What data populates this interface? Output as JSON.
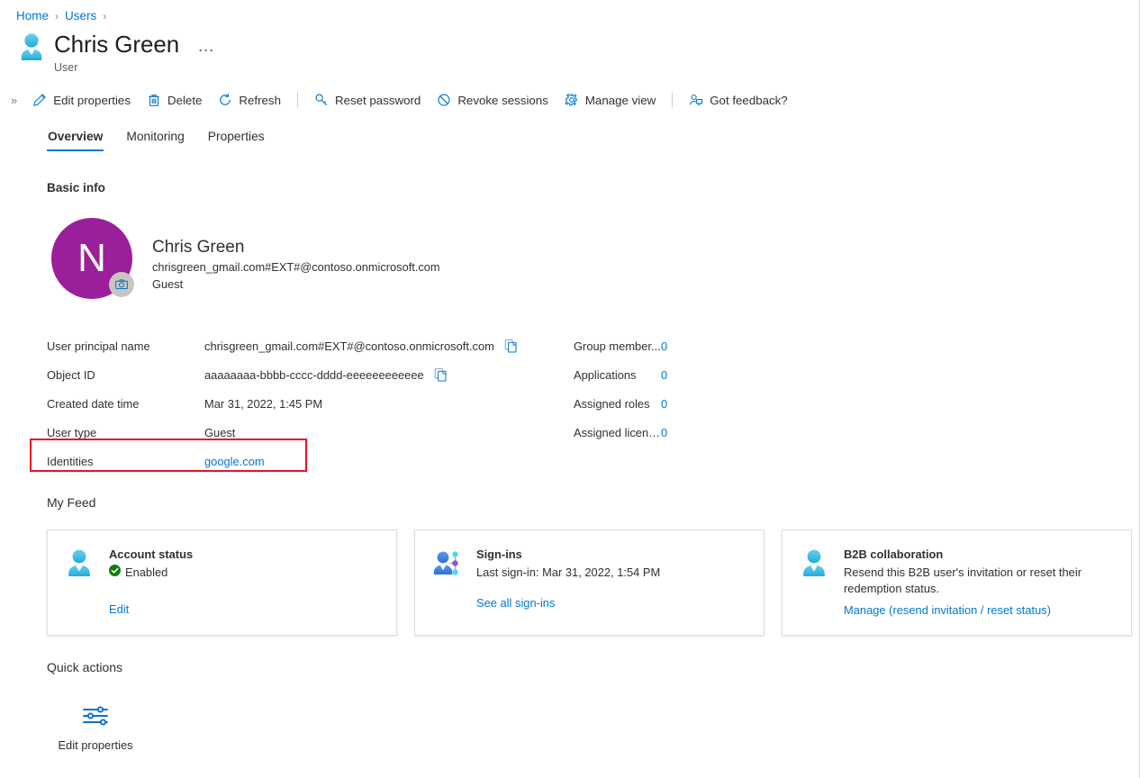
{
  "breadcrumb": {
    "items": [
      {
        "label": "Home"
      },
      {
        "label": "Users"
      }
    ],
    "separator": "›"
  },
  "header": {
    "title": "Chris Green",
    "subtitle": "User",
    "more_label": "…",
    "avatar_icon": "user-icon"
  },
  "toolbar": {
    "expand_label": "»",
    "items": [
      {
        "label": "Edit properties",
        "icon": "pencil-icon"
      },
      {
        "label": "Delete",
        "icon": "trash-icon"
      },
      {
        "label": "Refresh",
        "icon": "refresh-icon"
      },
      {
        "label": "Reset password",
        "icon": "key-icon"
      },
      {
        "label": "Revoke sessions",
        "icon": "block-icon"
      },
      {
        "label": "Manage view",
        "icon": "gear-icon"
      },
      {
        "label": "Got feedback?",
        "icon": "feedback-icon"
      }
    ]
  },
  "tabs": [
    {
      "label": "Overview",
      "active": true
    },
    {
      "label": "Monitoring",
      "active": false
    },
    {
      "label": "Properties",
      "active": false
    }
  ],
  "sections": {
    "basic_info": "Basic info",
    "my_feed": "My Feed",
    "quick_actions": "Quick actions"
  },
  "identity": {
    "initial": "N",
    "avatar_color": "#9b1f9b",
    "camera_icon": "camera-icon",
    "name": "Chris Green",
    "upn": "chrisgreen_gmail.com#EXT#@contoso.onmicrosoft.com",
    "user_type": "Guest"
  },
  "properties_left": [
    {
      "label": "User principal name",
      "value": "chrisgreen_gmail.com#EXT#@contoso.onmicrosoft.com",
      "copy": true,
      "is_link": false
    },
    {
      "label": "Object ID",
      "value": "aaaaaaaa-bbbb-cccc-dddd-eeeeeeeeeeee",
      "copy": true,
      "is_link": false
    },
    {
      "label": "Created date time",
      "value": "Mar 31, 2022, 1:45 PM",
      "copy": false,
      "is_link": false
    },
    {
      "label": "User type",
      "value": "Guest",
      "copy": false,
      "is_link": false
    },
    {
      "label": "Identities",
      "value": "google.com",
      "copy": false,
      "is_link": true
    }
  ],
  "properties_right": [
    {
      "label": "Group member...",
      "value": "0"
    },
    {
      "label": "Applications",
      "value": "0"
    },
    {
      "label": "Assigned roles",
      "value": "0"
    },
    {
      "label": "Assigned licens...",
      "value": "0"
    }
  ],
  "highlight": {
    "color": "#e81123",
    "target": "identities-row"
  },
  "feed_cards": [
    {
      "title": "Account status",
      "status_text": "Enabled",
      "status_icon": "check-circle-icon",
      "status_color": "#107c10",
      "icon": "user-icon",
      "link": "Edit"
    },
    {
      "title": "Sign-ins",
      "subtitle": "Last sign-in: Mar 31, 2022, 1:54 PM",
      "icon": "user-network-icon",
      "link": "See all sign-ins"
    },
    {
      "title": "B2B collaboration",
      "subtitle": "Resend this B2B user's invitation or reset their redemption status.",
      "icon": "user-icon",
      "link": "Manage (resend invitation / reset status)"
    }
  ],
  "quick_action_items": [
    {
      "label": "Edit properties",
      "icon": "sliders-icon"
    }
  ],
  "colors": {
    "accent": "#0078d4",
    "text": "#323130",
    "subtle_text": "#605e5c",
    "border": "#e1dfdd",
    "highlight": "#e81123",
    "success": "#107c10",
    "avatar_purple": "#9b1f9b"
  }
}
